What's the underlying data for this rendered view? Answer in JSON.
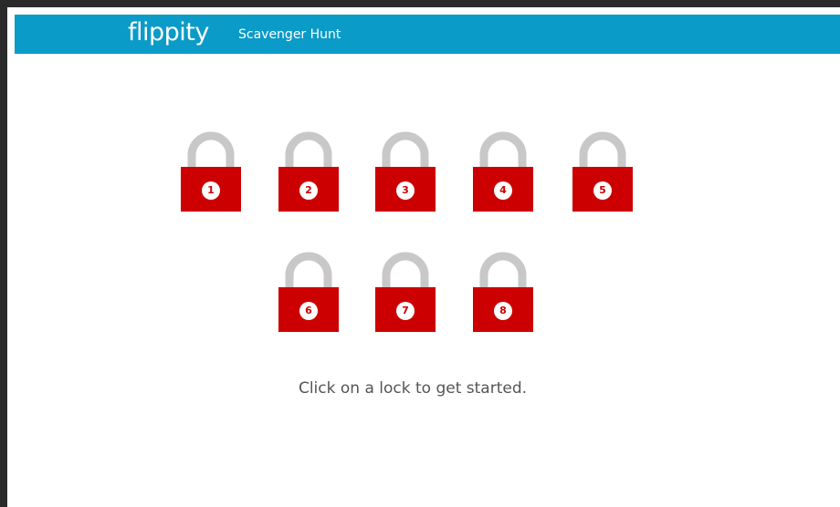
{
  "header": {
    "logo_text": "flippity",
    "app_title": "Scavenger Hunt"
  },
  "colors": {
    "header_bg": "#0a9bc8",
    "lock_body": "#cc0000",
    "lock_shackle": "#c8c8c8"
  },
  "locks": [
    {
      "label": "1"
    },
    {
      "label": "2"
    },
    {
      "label": "3"
    },
    {
      "label": "4"
    },
    {
      "label": "5"
    },
    {
      "label": "6"
    },
    {
      "label": "7"
    },
    {
      "label": "8"
    }
  ],
  "instructions": "Click on a lock to get started."
}
